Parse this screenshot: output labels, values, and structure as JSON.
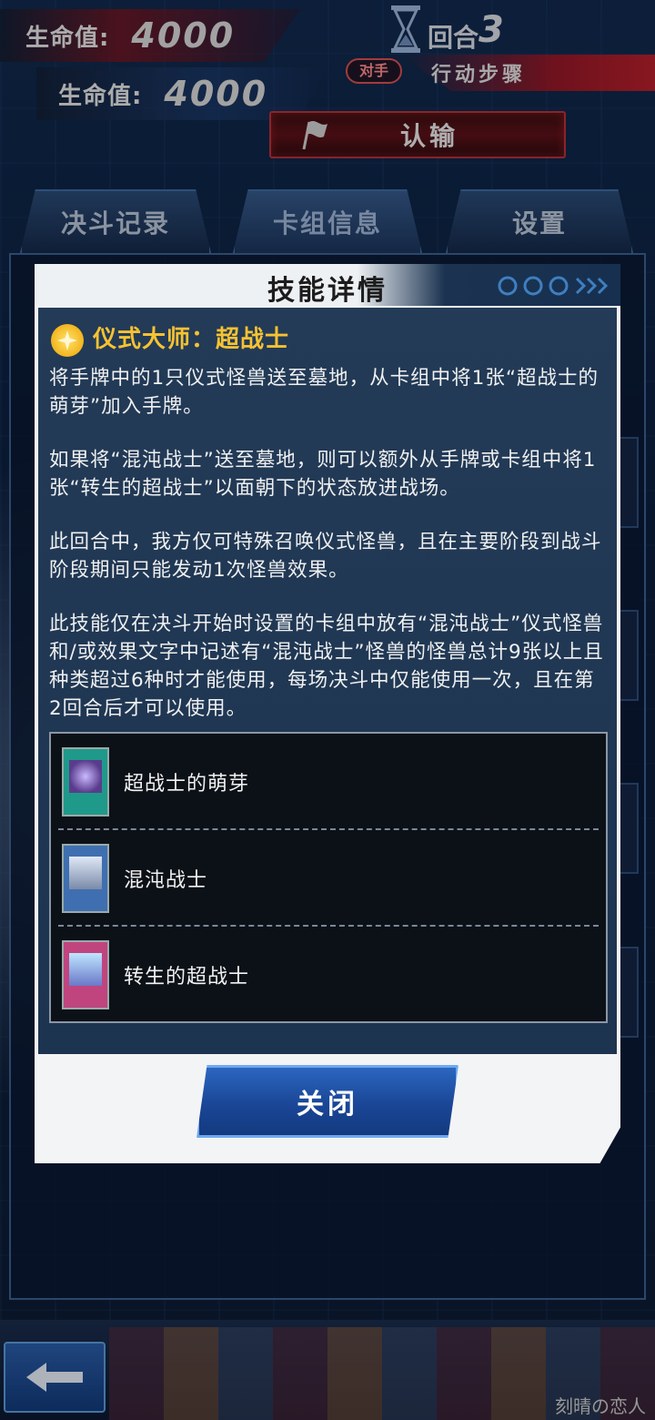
{
  "hud": {
    "opponent_life_label": "生命值:",
    "opponent_life_value": "4000",
    "player_life_label": "生命值:",
    "player_life_value": "4000",
    "turn_label": "回合",
    "turn_number": "3",
    "turn_owner_badge": "对手",
    "phase": "行动步骤",
    "surrender_label": "认输"
  },
  "tabs": [
    {
      "label": "决斗记录"
    },
    {
      "label": "卡组信息"
    },
    {
      "label": "设置"
    }
  ],
  "active_tab": "卡组信息",
  "modal": {
    "title": "技能详情",
    "skill_name": "仪式大师：超战士",
    "description": [
      "将手牌中的1只仪式怪兽送至墓地，从卡组中将1张“超战士的萌芽”加入手牌。",
      "如果将“混沌战士”送至墓地，则可以额外从手牌或卡组中将1张“转生的超战士”以面朝下的状态放进战场。",
      "此回合中，我方仅可特殊召唤仪式怪兽，且在主要阶段到战斗阶段期间只能发动1次怪兽效果。",
      "此技能仅在决斗开始时设置的卡组中放有“混沌战士”仪式怪兽和/或效果文字中记述有“混沌战士”怪兽的怪兽总计9张以上且种类超过6种时才能使用，每场决斗中仅能使用一次，且在第2回合后才可以使用。"
    ],
    "cards": [
      {
        "name": "超战士的萌芽",
        "color": "#1f9a8a"
      },
      {
        "name": "混沌战士",
        "color": "#3f6fb0"
      },
      {
        "name": "转生的超战士",
        "color": "#c0457f"
      }
    ],
    "close_label": "关闭"
  },
  "watermark": "刻晴の恋人",
  "colors": {
    "accent_gold": "#f7c232",
    "button_blue": "#1a4696",
    "surrender_red": "#5b1118"
  }
}
